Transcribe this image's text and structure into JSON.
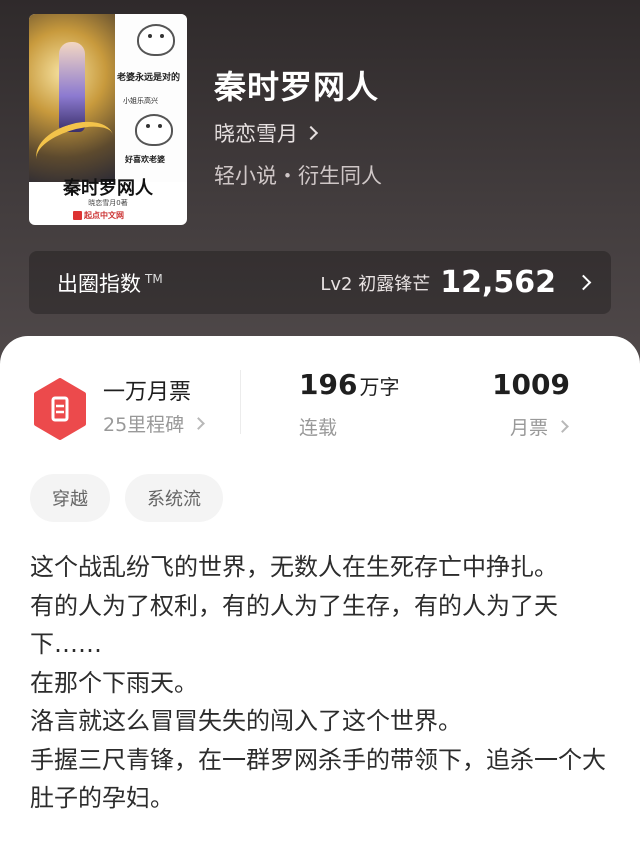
{
  "book": {
    "title": "秦时罗网人",
    "author": "晓恋雪月",
    "genre": "轻小说・衍生同人"
  },
  "cover": {
    "slogan": "老婆永远是对的",
    "small_text": "小姐乐高兴",
    "bottom_text": "好喜欢老婆",
    "title": "秦时罗网人",
    "author_line": "晓恋雪月0著",
    "publisher": "起点中文网"
  },
  "index": {
    "label": "出圈指数",
    "tm": "TM",
    "level": "Lv2 初露锋芒",
    "value": "12,562"
  },
  "stats": {
    "milestone_title": "一万月票",
    "milestone_sub": "25里程碑",
    "words_value": "196",
    "words_unit": "万字",
    "words_label": "连载",
    "tickets_value": "1009",
    "tickets_label": "月票"
  },
  "tags": [
    "穿越",
    "系统流"
  ],
  "description": [
    "这个战乱纷飞的世界，无数人在生死存亡中挣扎。",
    "有的人为了权利，有的人为了生存，有的人为了天下……",
    "在那个下雨天。",
    "洛言就这么冒冒失失的闯入了这个世界。",
    "手握三尺青锋，在一群罗网杀手的带领下，追杀一个大肚子的孕妇。"
  ],
  "colors": {
    "badge": "#ec4a4c",
    "accent_text": "#ffffff"
  }
}
